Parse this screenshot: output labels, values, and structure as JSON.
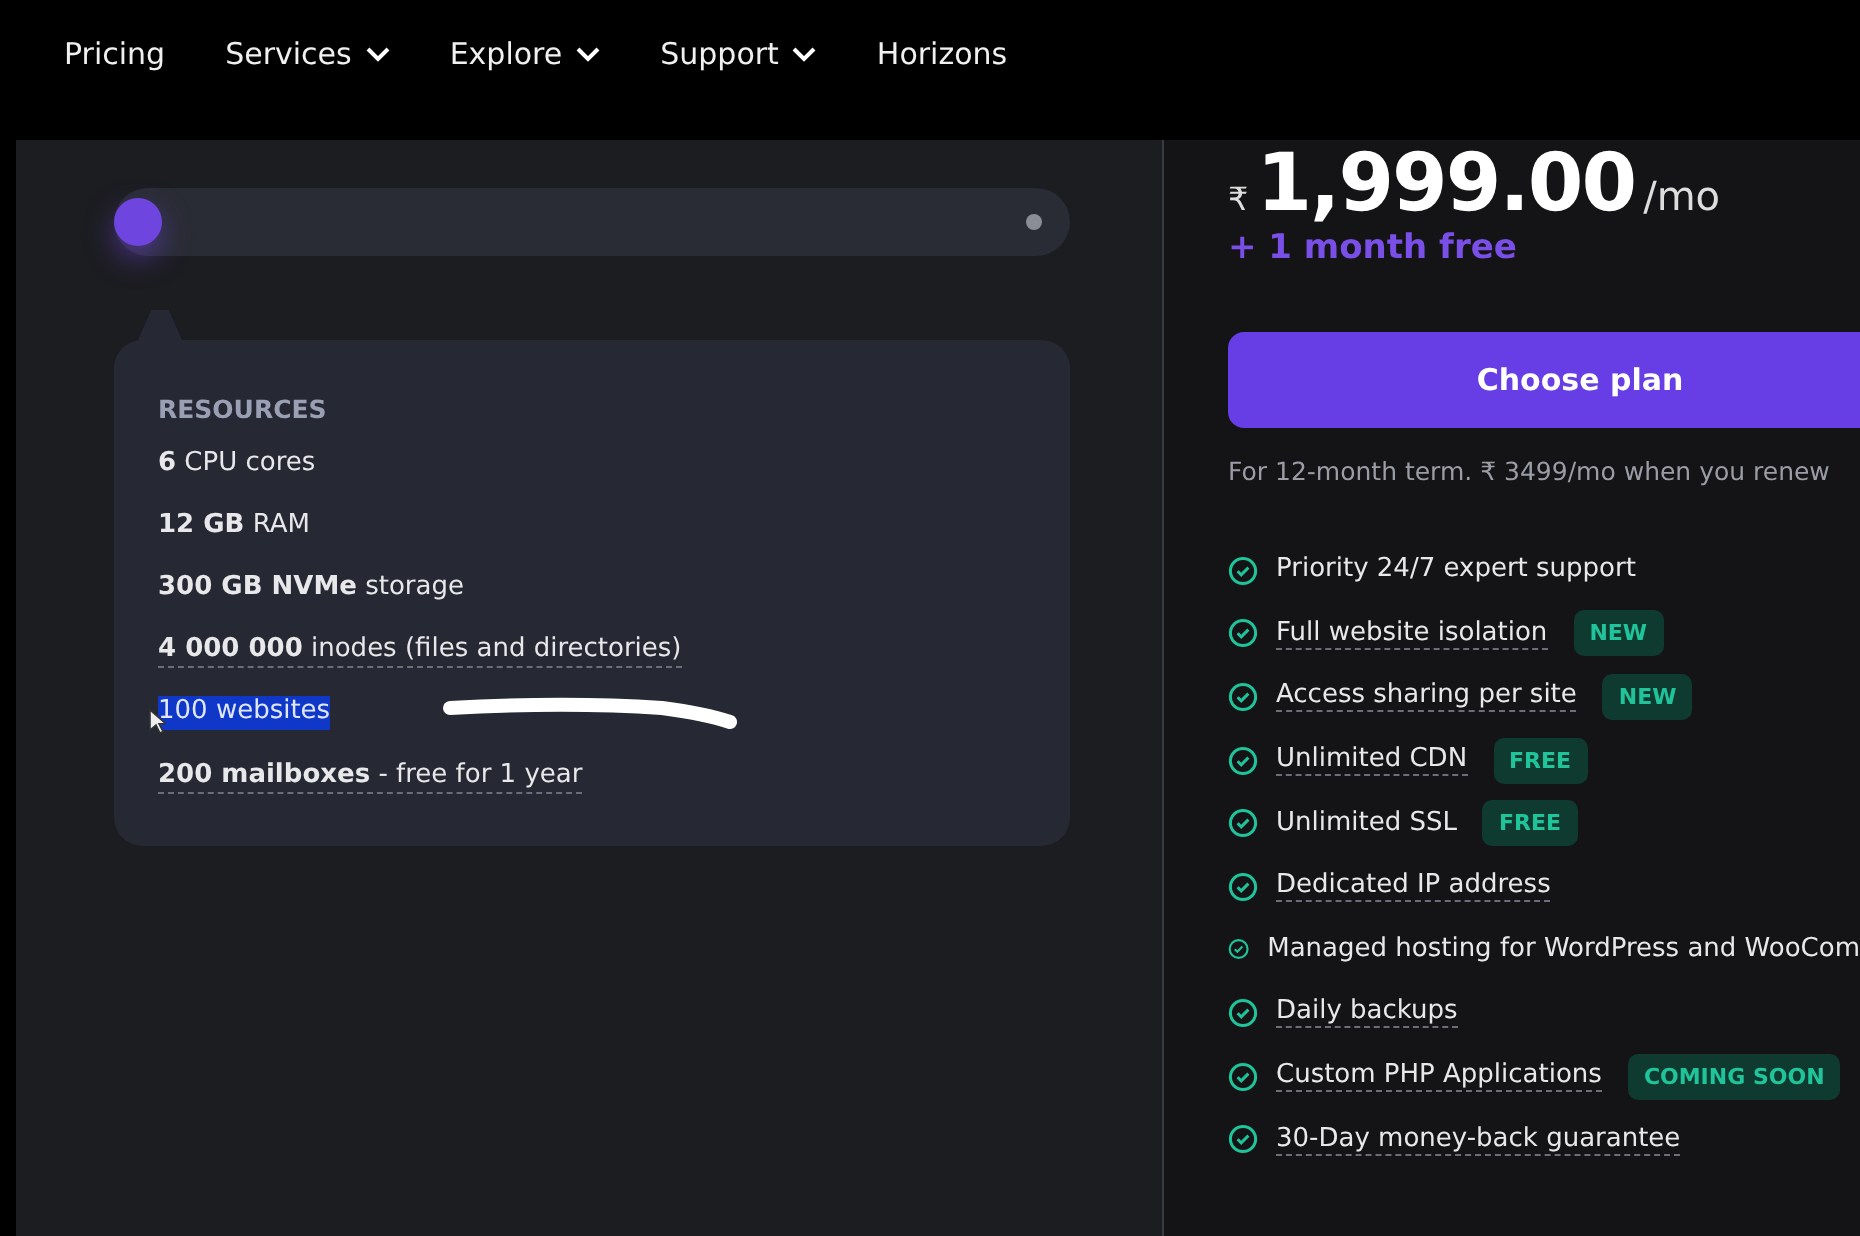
{
  "nav": {
    "items": [
      {
        "label": "Pricing",
        "dropdown": false
      },
      {
        "label": "Services",
        "dropdown": true
      },
      {
        "label": "Explore",
        "dropdown": true
      },
      {
        "label": "Support",
        "dropdown": true
      },
      {
        "label": "Horizons",
        "dropdown": false
      }
    ]
  },
  "slider": {
    "level": 0
  },
  "resources": {
    "title": "RESOURCES",
    "items": [
      {
        "text": "**6** CPU cores",
        "underlined": false,
        "selected": false
      },
      {
        "text": "**12 GB** RAM",
        "underlined": false,
        "selected": false
      },
      {
        "text": "**300 GB NVMe** storage",
        "underlined": false,
        "selected": false
      },
      {
        "text": "**4 000 000** inodes (files and directories)",
        "underlined": true,
        "selected": false
      },
      {
        "text": "100 websites",
        "underlined": false,
        "selected": true
      },
      {
        "text": "**200 mailboxes** - free for 1 year",
        "underlined": true,
        "selected": false
      }
    ]
  },
  "plan": {
    "currency": "₹",
    "price": "1,999.00",
    "period": "/mo",
    "bonus": "+ 1 month free",
    "button": "Choose plan",
    "renew_note": "For 12-month term. ₹ 3499/mo when you renew",
    "features": [
      {
        "text": "Priority 24/7 expert support",
        "underlined": false
      },
      {
        "text": "Full website isolation",
        "underlined": true,
        "badge": "NEW"
      },
      {
        "text": "Access sharing per site",
        "underlined": true,
        "badge": "NEW"
      },
      {
        "text": "Unlimited CDN",
        "underlined": true,
        "badge": "FREE"
      },
      {
        "text": "Unlimited SSL",
        "underlined": false,
        "badge": "FREE"
      },
      {
        "text": "Dedicated IP address",
        "underlined": true
      },
      {
        "text": "Managed hosting for WordPress and WooCom",
        "underlined": false
      },
      {
        "text": "Daily backups",
        "underlined": true
      },
      {
        "text": "Custom PHP Applications",
        "underlined": true,
        "badge": "COMING SOON"
      },
      {
        "text": "30-Day money-back guarantee",
        "underlined": true
      }
    ]
  }
}
